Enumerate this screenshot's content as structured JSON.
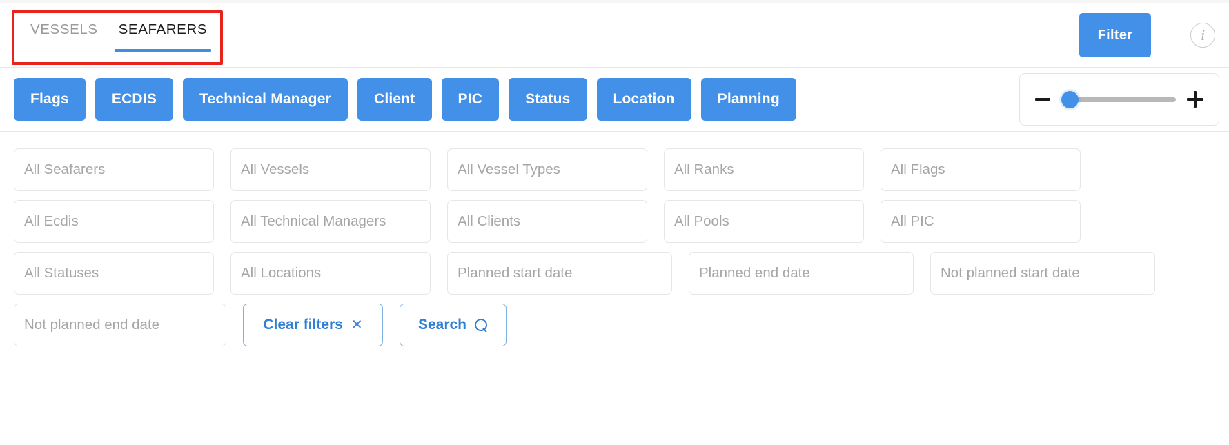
{
  "header": {
    "tabs": [
      {
        "label": "VESSELS",
        "active": false
      },
      {
        "label": "SEAFARERS",
        "active": true
      }
    ],
    "filter_button": "Filter",
    "info_icon": "info-circle-icon"
  },
  "chips": [
    {
      "label": "Flags"
    },
    {
      "label": "ECDIS"
    },
    {
      "label": "Technical Manager"
    },
    {
      "label": "Client"
    },
    {
      "label": "PIC"
    },
    {
      "label": "Status"
    },
    {
      "label": "Location"
    },
    {
      "label": "Planning"
    }
  ],
  "zoom_control": {
    "minus_icon": "minus-icon",
    "plus_icon": "plus-icon",
    "value": 0,
    "min": 0,
    "max": 100
  },
  "filters": {
    "row1": [
      {
        "placeholder": "All Seafarers",
        "value": "",
        "key": "seafarers"
      },
      {
        "placeholder": "All Vessels",
        "value": "",
        "key": "vessels"
      },
      {
        "placeholder": "All Vessel Types",
        "value": "",
        "key": "vessel-types"
      },
      {
        "placeholder": "All Ranks",
        "value": "",
        "key": "ranks"
      },
      {
        "placeholder": "All Flags",
        "value": "",
        "key": "flags"
      }
    ],
    "row2": [
      {
        "placeholder": "All Ecdis",
        "value": "",
        "key": "ecdis"
      },
      {
        "placeholder": "All Technical Managers",
        "value": "",
        "key": "technical-managers"
      },
      {
        "placeholder": "All Clients",
        "value": "",
        "key": "clients"
      },
      {
        "placeholder": "All Pools",
        "value": "",
        "key": "pools"
      },
      {
        "placeholder": "All PIC",
        "value": "",
        "key": "pic"
      }
    ],
    "row3": [
      {
        "placeholder": "All Statuses",
        "value": "",
        "key": "statuses"
      },
      {
        "placeholder": "All Locations",
        "value": "",
        "key": "locations"
      },
      {
        "placeholder": "Planned start date",
        "value": "",
        "key": "planned-start-date"
      },
      {
        "placeholder": "Planned end date",
        "value": "",
        "key": "planned-end-date"
      },
      {
        "placeholder": "Not planned start date",
        "value": "",
        "key": "not-planned-start-date"
      }
    ],
    "row4": [
      {
        "placeholder": "Not planned end date",
        "value": "",
        "key": "not-planned-end-date"
      }
    ]
  },
  "actions": {
    "clear_filters": "Clear filters",
    "clear_icon": "close-x-icon",
    "search": "Search",
    "search_icon": "magnifier-icon"
  },
  "colors": {
    "accent_blue": "#4290e8",
    "highlight_red": "#e8231c",
    "link_blue": "#2f7fd4",
    "placeholder_gray": "#a6a6a6",
    "border_gray": "#e6e6e6"
  }
}
